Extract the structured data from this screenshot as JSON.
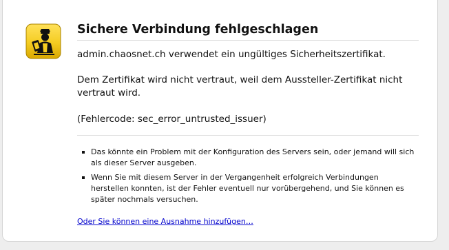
{
  "error": {
    "title": "Sichere Verbindung fehlgeschlagen",
    "short_description": "admin.chaosnet.ch verwendet ein ungültiges Sicherheitszertifikat.",
    "long_description": "Dem Zertifikat wird nicht vertraut, weil dem Aussteller-Zertifikat nicht vertraut wird.",
    "error_code": "(Fehlercode: sec_error_untrusted_issuer)",
    "reasons": [
      "Das könnte ein Problem mit der Konfiguration des Servers sein, oder jemand will sich als dieser Server ausgeben.",
      "Wenn Sie mit diesem Server in der Vergangenheit erfolgreich Verbindungen herstellen konnten, ist der Fehler eventuell nur vorübergehend, und Sie können es später nochmals versuchen."
    ],
    "exception_link": "Oder Sie können eine Ausnahme hinzufügen…"
  },
  "icons": {
    "warning": "security-officer-warning-icon"
  },
  "colors": {
    "background": "#eeeeee",
    "card": "#ffffff",
    "icon_yellow": "#f4cc21",
    "link": "#0000cc"
  }
}
